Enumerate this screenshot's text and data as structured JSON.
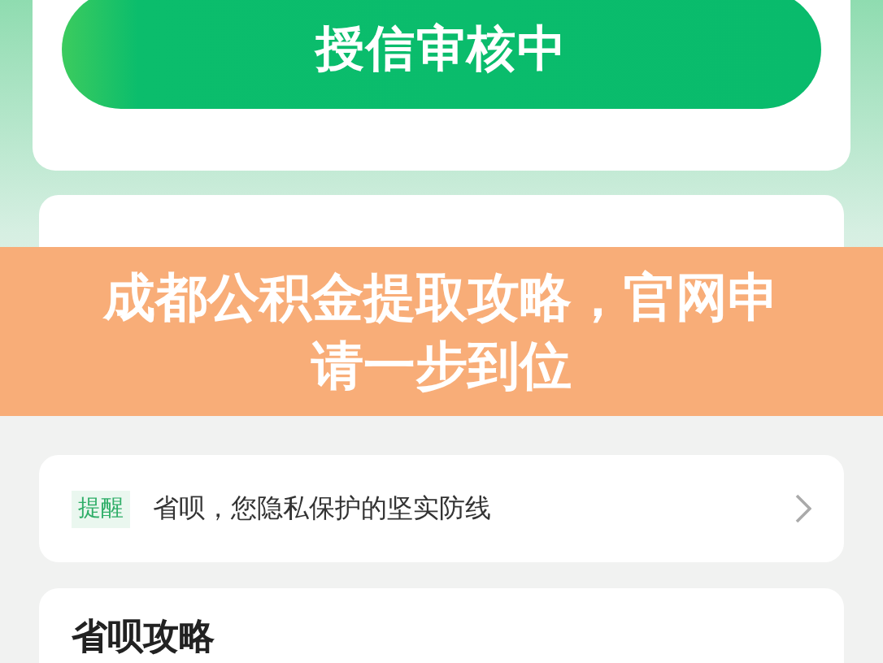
{
  "status_card": {
    "button": "授信审核中"
  },
  "overlay": {
    "title": "成都公积金提取攻略，官网申请一步到位"
  },
  "notice": {
    "tag": "提醒",
    "text": "省呗，您隐私保护的坚实防线"
  },
  "guide": {
    "title": "省呗攻略"
  }
}
